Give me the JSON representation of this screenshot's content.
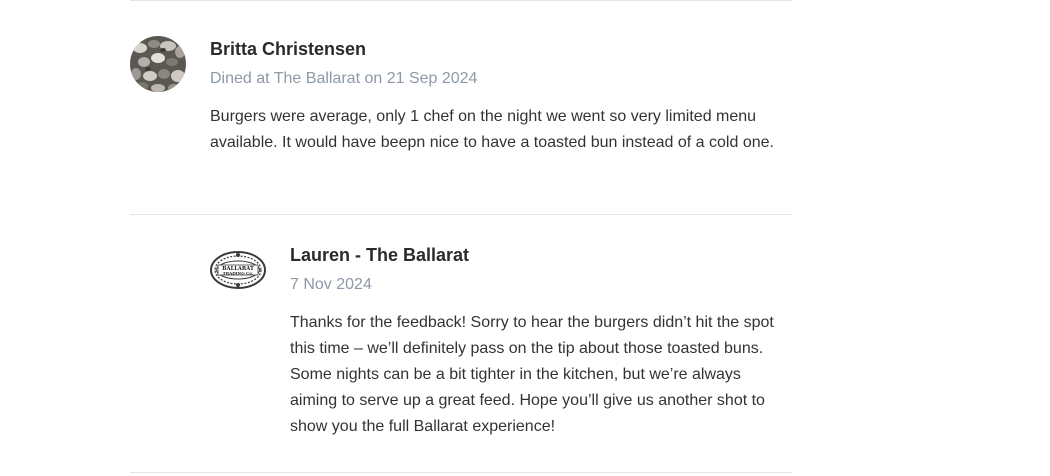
{
  "review": {
    "reviewer_name": "Britta Christensen",
    "dined_info": "Dined at The Ballarat on 21 Sep 2024",
    "text": "Burgers were average, only 1 chef on the night we went so very limited menu available. It would have beepn nice to have a toasted bun instead of a cold one.",
    "avatar_icon": "pebbles-photo-avatar"
  },
  "reply": {
    "author_name": "Lauren - The Ballarat",
    "date": "7 Nov 2024",
    "text": "Thanks for the feedback! Sorry to hear the burgers didn’t hit the spot this time – we’ll definitely pass on the tip about those toasted buns. Some nights can be a bit tighter in the kitchen, but we’re always aiming to serve up a great feed. Hope you’ll give us another shot to show you the full Ballarat experience!",
    "logo_text_line1": "BALLARAT",
    "logo_text_line2": "TRADING Co.",
    "avatar_icon": "ballarat-trading-co-logo"
  },
  "colors": {
    "name": "#2b2b2b",
    "meta": "#8e99a8",
    "body": "#333333",
    "divider": "#e6e6e6"
  }
}
